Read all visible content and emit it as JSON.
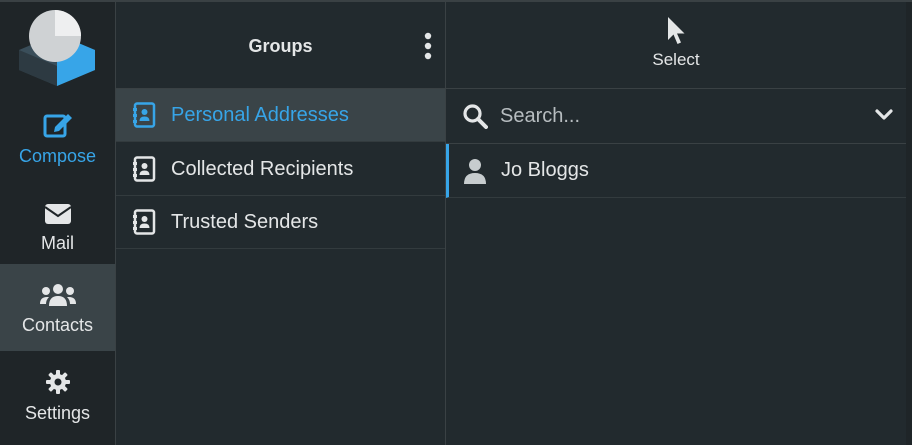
{
  "nav": {
    "items": [
      {
        "id": "compose",
        "label": "Compose",
        "icon": "compose-icon"
      },
      {
        "id": "mail",
        "label": "Mail",
        "icon": "envelope-icon"
      },
      {
        "id": "contacts",
        "label": "Contacts",
        "icon": "users-icon"
      },
      {
        "id": "settings",
        "label": "Settings",
        "icon": "gear-icon"
      }
    ],
    "active": "contacts"
  },
  "groups": {
    "title": "Groups",
    "items": [
      {
        "label": "Personal Addresses",
        "active": true
      },
      {
        "label": "Collected Recipients",
        "active": false
      },
      {
        "label": "Trusted Senders",
        "active": false
      }
    ]
  },
  "list": {
    "select_label": "Select",
    "search": {
      "placeholder": "Search..."
    },
    "contacts": [
      {
        "name": "Jo Bloggs"
      }
    ]
  },
  "colors": {
    "accent": "#37a5e8",
    "background": "#222a2e",
    "nav_background": "#1f2528",
    "active_background": "#3a4448",
    "text": "#e4e6e7"
  }
}
